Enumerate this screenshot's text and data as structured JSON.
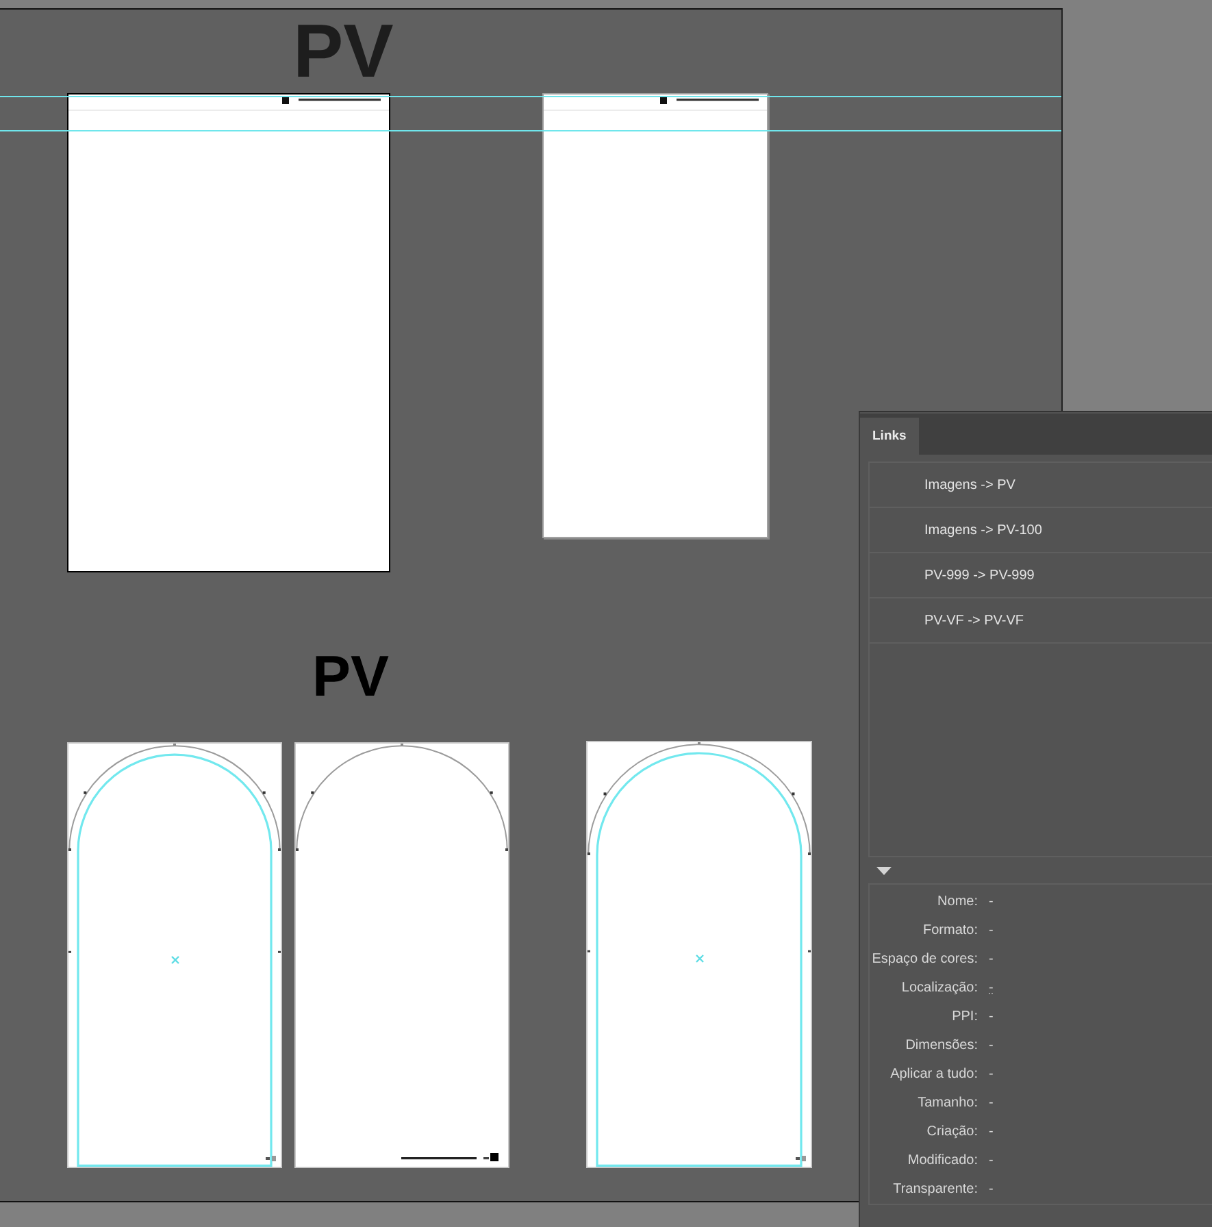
{
  "canvas": {
    "titles": [
      "PV",
      "PV"
    ],
    "artboards": [
      {
        "kind": "page"
      },
      {
        "kind": "page"
      },
      {
        "kind": "arch"
      },
      {
        "kind": "arc"
      },
      {
        "kind": "arch"
      }
    ]
  },
  "links_panel": {
    "tabs": [
      {
        "label": "Links",
        "selected": true
      }
    ],
    "links": [
      {
        "label": "Imagens -> PV",
        "selected": false
      },
      {
        "label": "Imagens -> PV-100",
        "selected": false
      },
      {
        "label": "PV-999 -> PV-999",
        "selected": false
      },
      {
        "label": "PV-VF -> PV-VF",
        "selected": false
      }
    ],
    "info_expanded": true,
    "info": [
      {
        "name": "Nome:",
        "text": "-",
        "kind": "text"
      },
      {
        "name": "Formato:",
        "text": "-",
        "kind": "text"
      },
      {
        "name": "Espaço de cores:",
        "text": "-",
        "kind": "text"
      },
      {
        "name": "Localização:",
        "text": "-",
        "kind": "link"
      },
      {
        "name": "PPI:",
        "text": "-",
        "kind": "text"
      },
      {
        "name": "Dimensões:",
        "text": "-",
        "kind": "text"
      },
      {
        "name": "Aplicar a tudo:",
        "text": "-",
        "kind": "text"
      },
      {
        "name": "Tamanho:",
        "text": "-",
        "kind": "text"
      },
      {
        "name": "Criação:",
        "text": "-",
        "kind": "text"
      },
      {
        "name": "Modificado:",
        "text": "-",
        "kind": "text"
      },
      {
        "name": "Transparente:",
        "text": "-",
        "kind": "text"
      }
    ]
  }
}
